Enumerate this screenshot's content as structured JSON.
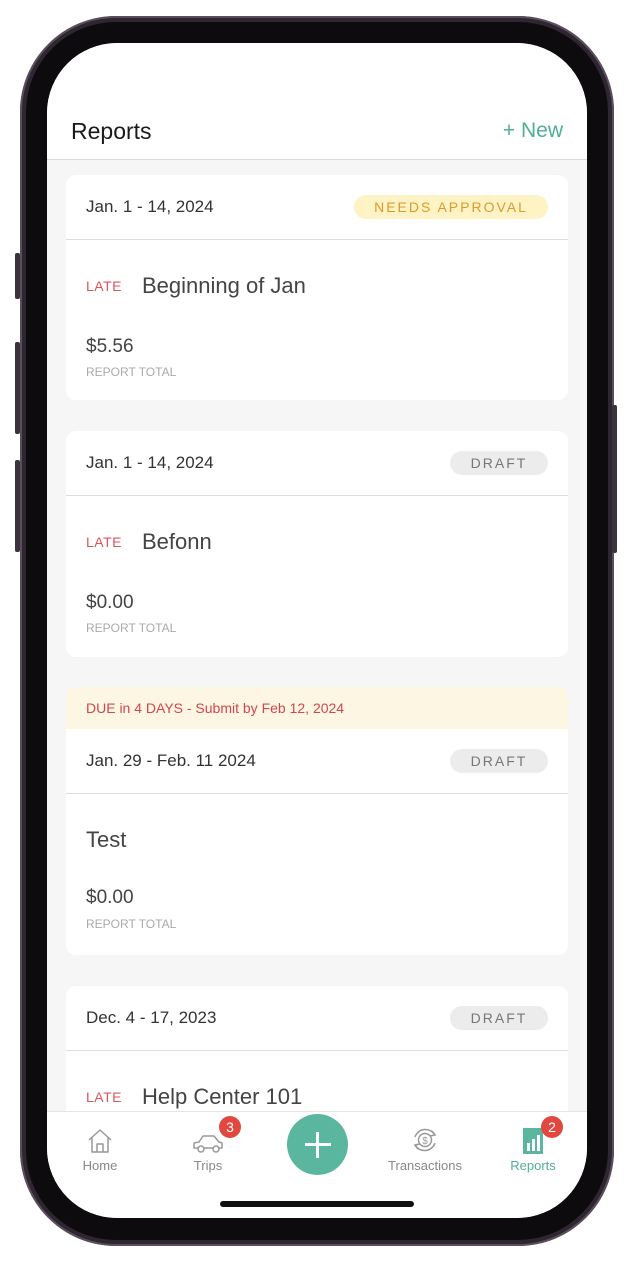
{
  "header": {
    "title": "Reports",
    "new_label": "+ New"
  },
  "reports": [
    {
      "date": "Jan. 1 - 14, 2024",
      "status": "NEEDS APPROVAL",
      "late": "LATE",
      "name": "Beginning of Jan",
      "amount": "$5.56",
      "total_label": "REPORT TOTAL"
    },
    {
      "date": "Jan. 1 - 14, 2024",
      "status": "DRAFT",
      "late": "LATE",
      "name": "Befonn",
      "amount": "$0.00",
      "total_label": "REPORT TOTAL"
    },
    {
      "due": "DUE in 4 DAYS - Submit by Feb 12, 2024",
      "date": "Jan. 29 - Feb. 11 2024",
      "status": "DRAFT",
      "name": "Test",
      "amount": "$0.00",
      "total_label": "REPORT TOTAL"
    },
    {
      "date": "Dec. 4 - 17, 2023",
      "status": "DRAFT",
      "late": "LATE",
      "name": "Help Center 101"
    }
  ],
  "tabbar": {
    "home": "Home",
    "trips": "Trips",
    "trips_badge": "3",
    "transactions": "Transactions",
    "reports": "Reports",
    "reports_badge": "2"
  },
  "colors": {
    "accent": "#4fae98",
    "late": "#d9575f",
    "badge_red": "#e1483f"
  },
  "icons": [
    "house-icon",
    "car-icon",
    "plus-icon",
    "dollar-cycle-icon",
    "bar-chart-icon"
  ]
}
